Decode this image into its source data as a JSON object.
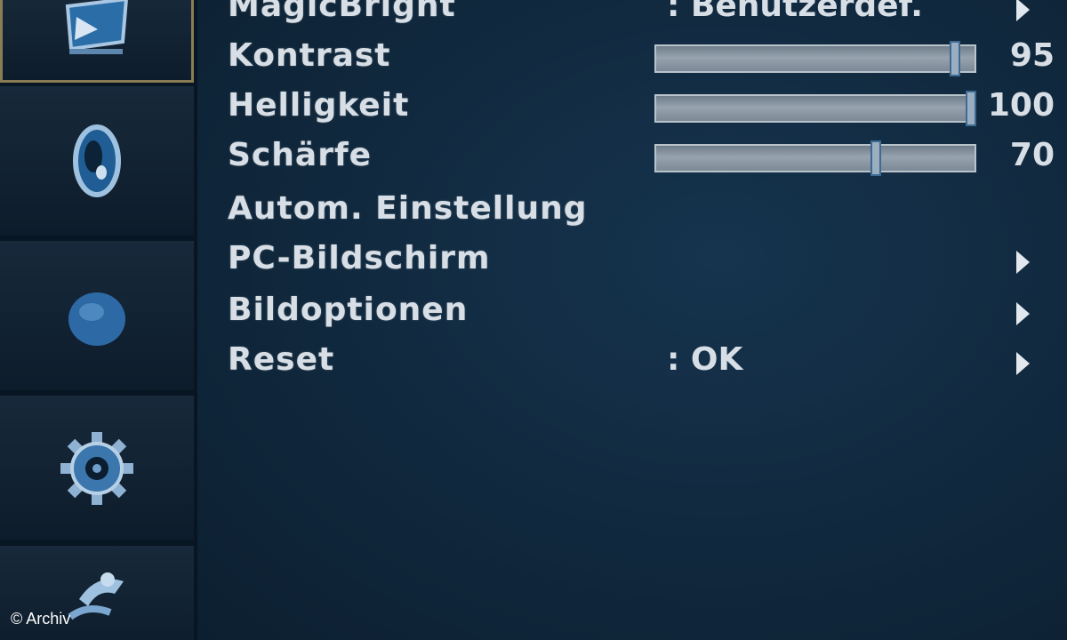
{
  "menu": {
    "items": [
      {
        "label": "MagicBright",
        "value": ": Benutzerdef.",
        "submenu": true
      },
      {
        "label": "Kontrast",
        "slider": 95,
        "max": 100
      },
      {
        "label": "Helligkeit",
        "slider": 100,
        "max": 100
      },
      {
        "label": "Schärfe",
        "slider": 70,
        "max": 100
      },
      {
        "label": "Autom. Einstellung"
      },
      {
        "label": "PC-Bildschirm",
        "submenu": true
      },
      {
        "label": "Bildoptionen",
        "submenu": true
      },
      {
        "label": "Reset",
        "value": ": OK",
        "submenu": true
      }
    ]
  },
  "sidebar": {
    "icons": [
      "picture-icon",
      "color-icon",
      "image-size-icon",
      "setup-icon",
      "information-icon"
    ],
    "selected": 0
  },
  "watermark": "© Archiv",
  "colors": {
    "background": "#112a40",
    "sidebar": "#081522",
    "selection_border": "#8a7d55",
    "text": "#d7dee5",
    "slider_handle_border": "#3d6a93"
  }
}
